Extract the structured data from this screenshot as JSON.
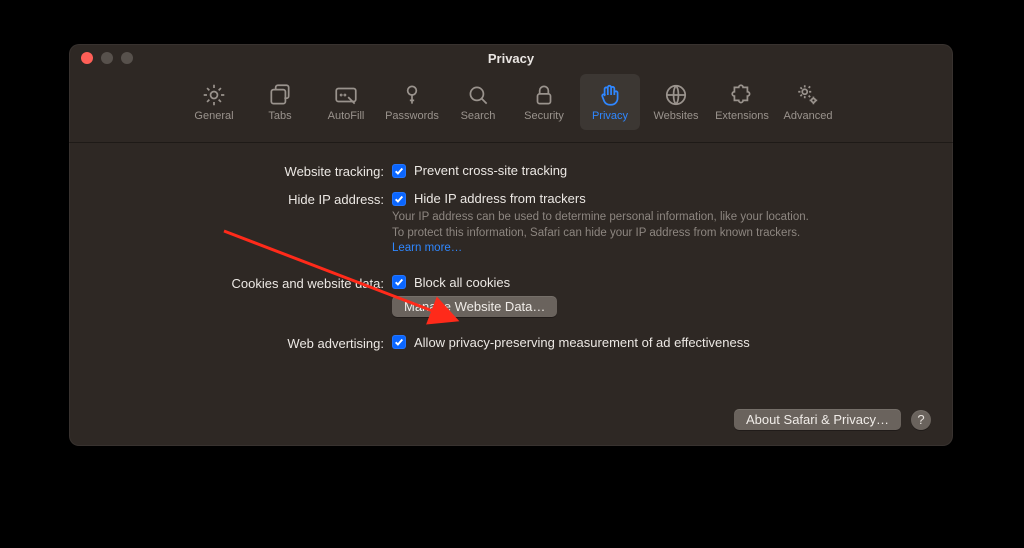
{
  "window": {
    "title": "Privacy"
  },
  "tabs": [
    {
      "id": "general",
      "label": "General"
    },
    {
      "id": "tabs",
      "label": "Tabs"
    },
    {
      "id": "autofill",
      "label": "AutoFill"
    },
    {
      "id": "passwords",
      "label": "Passwords"
    },
    {
      "id": "search",
      "label": "Search"
    },
    {
      "id": "security",
      "label": "Security"
    },
    {
      "id": "privacy",
      "label": "Privacy",
      "selected": true
    },
    {
      "id": "websites",
      "label": "Websites"
    },
    {
      "id": "extensions",
      "label": "Extensions"
    },
    {
      "id": "advanced",
      "label": "Advanced"
    }
  ],
  "rows": {
    "tracking": {
      "label": "Website tracking:",
      "checkbox_label": "Prevent cross-site tracking",
      "checked": true
    },
    "hideip": {
      "label": "Hide IP address:",
      "checkbox_label": "Hide IP address from trackers",
      "checked": true,
      "desc": "Your IP address can be used to determine personal information, like your location. To protect this information, Safari can hide your IP address from known trackers. ",
      "learn_more": "Learn more…"
    },
    "cookies": {
      "label": "Cookies and website data:",
      "checkbox_label": "Block all cookies",
      "checked": true,
      "manage_button": "Manage Website Data…"
    },
    "ads": {
      "label": "Web advertising:",
      "checkbox_label": "Allow privacy-preserving measurement of ad effectiveness",
      "checked": true
    }
  },
  "footer": {
    "about_button": "About Safari & Privacy…",
    "help": "?"
  }
}
